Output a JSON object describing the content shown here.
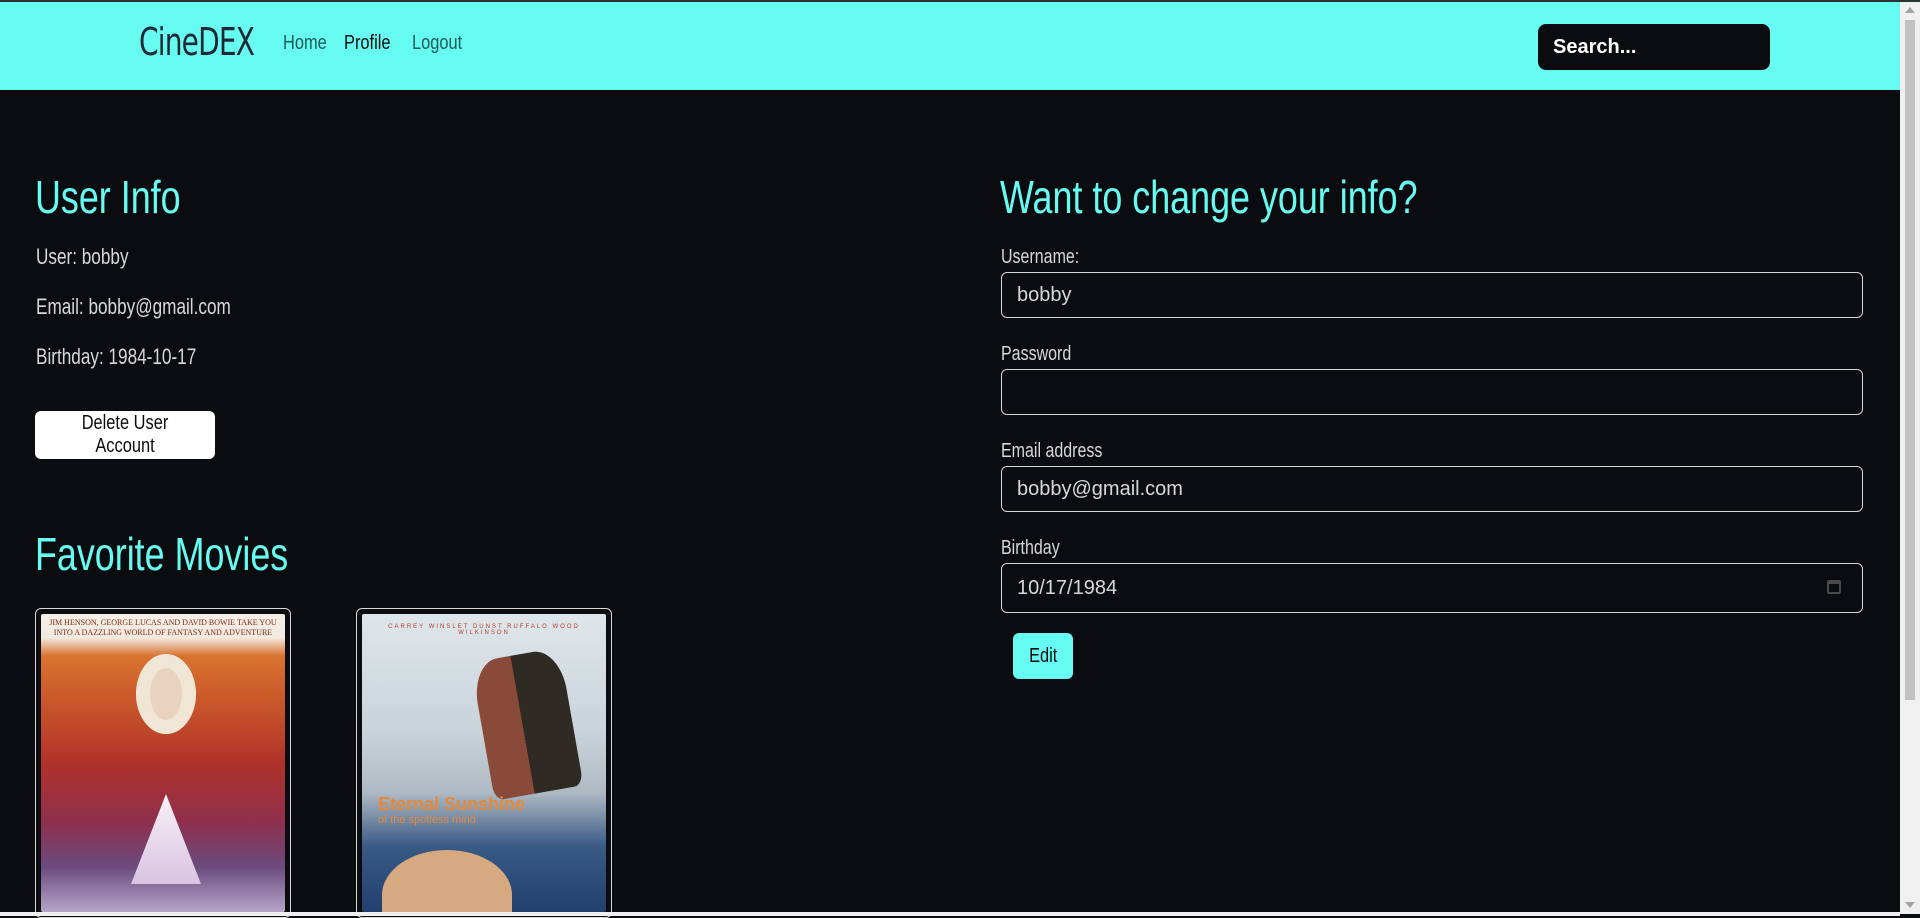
{
  "app": {
    "brand": "CineDEX"
  },
  "nav": {
    "links": [
      {
        "label": "Home"
      },
      {
        "label": "Profile"
      },
      {
        "label": "Logout"
      }
    ],
    "search_placeholder": "Search..."
  },
  "user_info": {
    "title": "User Info",
    "user_line": "User: bobby",
    "email_line": "Email: bobby@gmail.com",
    "birthday_line": "Birthday: 1984-10-17",
    "delete_label": "Delete User Account"
  },
  "favorites": {
    "title": "Favorite Movies",
    "movies": [
      {
        "poster_text": "JIM HENSON, GEORGE LUCAS AND DAVID BOWIE TAKE YOU INTO A DAZZLING WORLD OF FANTASY AND ADVENTURE"
      },
      {
        "poster_title": "Eternal Sunshine",
        "poster_subtitle": "of the spotless mind",
        "poster_credits": "CARREY WINSLET DUNST RUFFALO WOOD WILKINSON"
      }
    ]
  },
  "edit_form": {
    "title": "Want to change your info?",
    "username_label": "Username:",
    "username_value": "bobby",
    "password_label": "Password",
    "password_value": "",
    "email_label": "Email address",
    "email_value": "bobby@gmail.com",
    "birthday_label": "Birthday",
    "birthday_value": "10/17/1984",
    "edit_label": "Edit"
  },
  "colors": {
    "accent": "#66fcf1",
    "background": "#0b0c10",
    "text": "#d8d8d8"
  }
}
